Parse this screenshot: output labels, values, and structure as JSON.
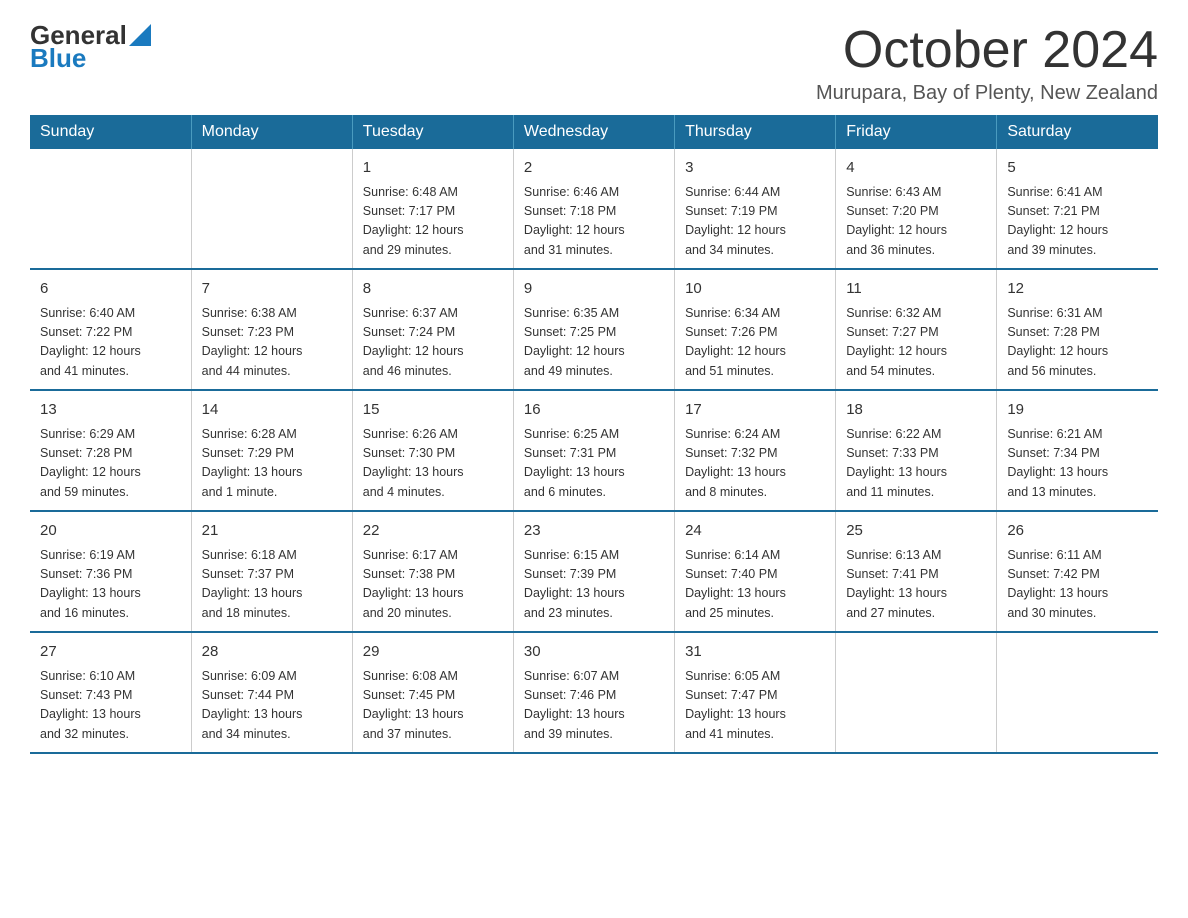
{
  "logo": {
    "general": "General",
    "blue": "Blue"
  },
  "title": "October 2024",
  "location": "Murupara, Bay of Plenty, New Zealand",
  "days_of_week": [
    "Sunday",
    "Monday",
    "Tuesday",
    "Wednesday",
    "Thursday",
    "Friday",
    "Saturday"
  ],
  "weeks": [
    [
      {
        "day": "",
        "info": ""
      },
      {
        "day": "",
        "info": ""
      },
      {
        "day": "1",
        "info": "Sunrise: 6:48 AM\nSunset: 7:17 PM\nDaylight: 12 hours\nand 29 minutes."
      },
      {
        "day": "2",
        "info": "Sunrise: 6:46 AM\nSunset: 7:18 PM\nDaylight: 12 hours\nand 31 minutes."
      },
      {
        "day": "3",
        "info": "Sunrise: 6:44 AM\nSunset: 7:19 PM\nDaylight: 12 hours\nand 34 minutes."
      },
      {
        "day": "4",
        "info": "Sunrise: 6:43 AM\nSunset: 7:20 PM\nDaylight: 12 hours\nand 36 minutes."
      },
      {
        "day": "5",
        "info": "Sunrise: 6:41 AM\nSunset: 7:21 PM\nDaylight: 12 hours\nand 39 minutes."
      }
    ],
    [
      {
        "day": "6",
        "info": "Sunrise: 6:40 AM\nSunset: 7:22 PM\nDaylight: 12 hours\nand 41 minutes."
      },
      {
        "day": "7",
        "info": "Sunrise: 6:38 AM\nSunset: 7:23 PM\nDaylight: 12 hours\nand 44 minutes."
      },
      {
        "day": "8",
        "info": "Sunrise: 6:37 AM\nSunset: 7:24 PM\nDaylight: 12 hours\nand 46 minutes."
      },
      {
        "day": "9",
        "info": "Sunrise: 6:35 AM\nSunset: 7:25 PM\nDaylight: 12 hours\nand 49 minutes."
      },
      {
        "day": "10",
        "info": "Sunrise: 6:34 AM\nSunset: 7:26 PM\nDaylight: 12 hours\nand 51 minutes."
      },
      {
        "day": "11",
        "info": "Sunrise: 6:32 AM\nSunset: 7:27 PM\nDaylight: 12 hours\nand 54 minutes."
      },
      {
        "day": "12",
        "info": "Sunrise: 6:31 AM\nSunset: 7:28 PM\nDaylight: 12 hours\nand 56 minutes."
      }
    ],
    [
      {
        "day": "13",
        "info": "Sunrise: 6:29 AM\nSunset: 7:28 PM\nDaylight: 12 hours\nand 59 minutes."
      },
      {
        "day": "14",
        "info": "Sunrise: 6:28 AM\nSunset: 7:29 PM\nDaylight: 13 hours\nand 1 minute."
      },
      {
        "day": "15",
        "info": "Sunrise: 6:26 AM\nSunset: 7:30 PM\nDaylight: 13 hours\nand 4 minutes."
      },
      {
        "day": "16",
        "info": "Sunrise: 6:25 AM\nSunset: 7:31 PM\nDaylight: 13 hours\nand 6 minutes."
      },
      {
        "day": "17",
        "info": "Sunrise: 6:24 AM\nSunset: 7:32 PM\nDaylight: 13 hours\nand 8 minutes."
      },
      {
        "day": "18",
        "info": "Sunrise: 6:22 AM\nSunset: 7:33 PM\nDaylight: 13 hours\nand 11 minutes."
      },
      {
        "day": "19",
        "info": "Sunrise: 6:21 AM\nSunset: 7:34 PM\nDaylight: 13 hours\nand 13 minutes."
      }
    ],
    [
      {
        "day": "20",
        "info": "Sunrise: 6:19 AM\nSunset: 7:36 PM\nDaylight: 13 hours\nand 16 minutes."
      },
      {
        "day": "21",
        "info": "Sunrise: 6:18 AM\nSunset: 7:37 PM\nDaylight: 13 hours\nand 18 minutes."
      },
      {
        "day": "22",
        "info": "Sunrise: 6:17 AM\nSunset: 7:38 PM\nDaylight: 13 hours\nand 20 minutes."
      },
      {
        "day": "23",
        "info": "Sunrise: 6:15 AM\nSunset: 7:39 PM\nDaylight: 13 hours\nand 23 minutes."
      },
      {
        "day": "24",
        "info": "Sunrise: 6:14 AM\nSunset: 7:40 PM\nDaylight: 13 hours\nand 25 minutes."
      },
      {
        "day": "25",
        "info": "Sunrise: 6:13 AM\nSunset: 7:41 PM\nDaylight: 13 hours\nand 27 minutes."
      },
      {
        "day": "26",
        "info": "Sunrise: 6:11 AM\nSunset: 7:42 PM\nDaylight: 13 hours\nand 30 minutes."
      }
    ],
    [
      {
        "day": "27",
        "info": "Sunrise: 6:10 AM\nSunset: 7:43 PM\nDaylight: 13 hours\nand 32 minutes."
      },
      {
        "day": "28",
        "info": "Sunrise: 6:09 AM\nSunset: 7:44 PM\nDaylight: 13 hours\nand 34 minutes."
      },
      {
        "day": "29",
        "info": "Sunrise: 6:08 AM\nSunset: 7:45 PM\nDaylight: 13 hours\nand 37 minutes."
      },
      {
        "day": "30",
        "info": "Sunrise: 6:07 AM\nSunset: 7:46 PM\nDaylight: 13 hours\nand 39 minutes."
      },
      {
        "day": "31",
        "info": "Sunrise: 6:05 AM\nSunset: 7:47 PM\nDaylight: 13 hours\nand 41 minutes."
      },
      {
        "day": "",
        "info": ""
      },
      {
        "day": "",
        "info": ""
      }
    ]
  ]
}
